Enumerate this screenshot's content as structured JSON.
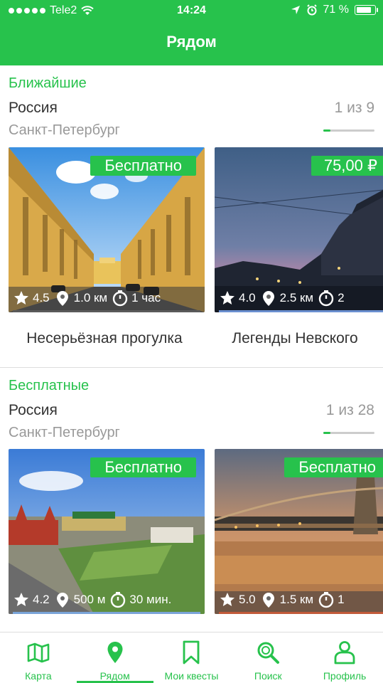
{
  "status_bar": {
    "carrier": "Tele2",
    "time": "14:24",
    "battery": "71 %"
  },
  "header": {
    "title": "Рядом"
  },
  "sections": [
    {
      "label": "Ближайшие",
      "country": "Россия",
      "city": "Санкт-Петербург",
      "counter": "1 из 9",
      "cards": [
        {
          "title": "Несерьёзная прогулка",
          "badge": "Бесплатно",
          "rating": "4.5",
          "distance": "1.0 км",
          "duration": "1 час"
        },
        {
          "title": "Легенды Невского",
          "badge": "75,00 ₽",
          "rating": "4.0",
          "distance": "2.5 км",
          "duration": "2"
        }
      ]
    },
    {
      "label": "Бесплатные",
      "country": "Россия",
      "city": "Санкт-Петербург",
      "counter": "1 из 28",
      "cards": [
        {
          "badge": "Бесплатно",
          "rating": "4.2",
          "distance": "500 м",
          "duration": "30 мин."
        },
        {
          "badge": "Бесплатно",
          "rating": "5.0",
          "distance": "1.5 км",
          "duration": "1"
        }
      ]
    }
  ],
  "tabs": [
    {
      "label": "Карта",
      "icon": "map-icon"
    },
    {
      "label": "Рядом",
      "icon": "location-pin-icon",
      "active": true
    },
    {
      "label": "Мои квесты",
      "icon": "bookmark-icon"
    },
    {
      "label": "Поиск",
      "icon": "search-icon"
    },
    {
      "label": "Профиль",
      "icon": "user-icon"
    }
  ],
  "colors": {
    "accent": "#27c24c"
  }
}
